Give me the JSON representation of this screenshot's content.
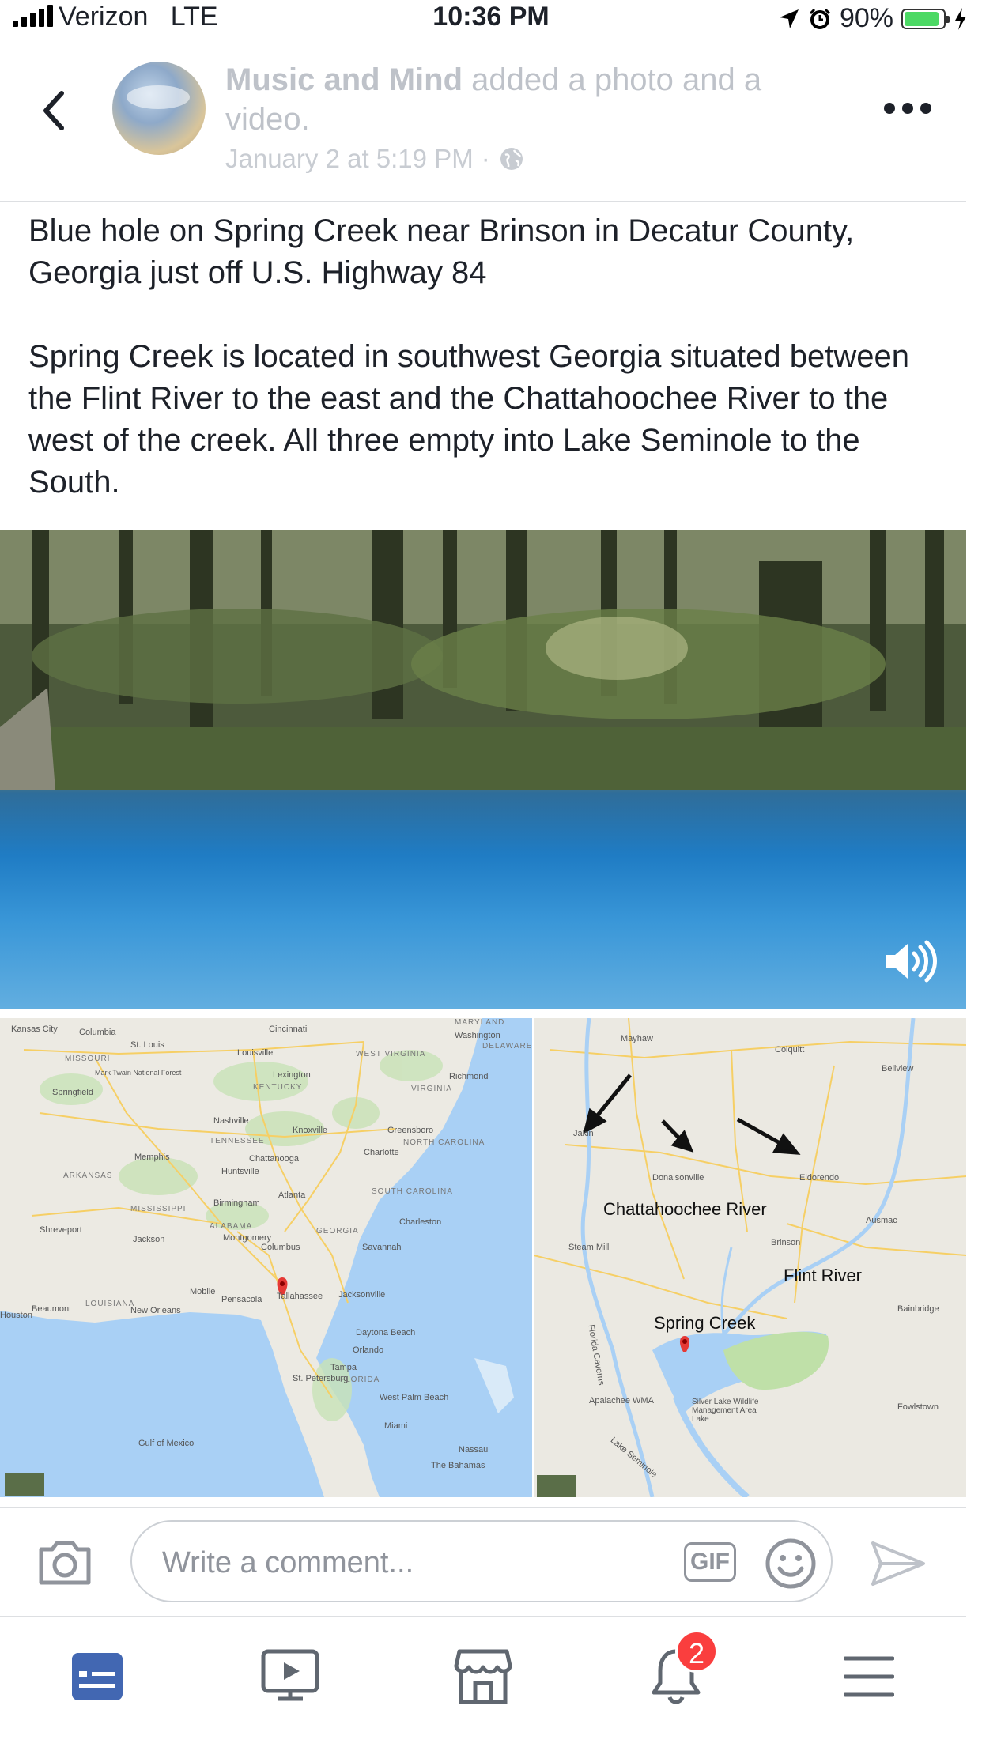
{
  "status_bar": {
    "carrier": "Verizon",
    "network": "LTE",
    "time": "10:36 PM",
    "battery_percent": "90%",
    "battery_level": 0.9
  },
  "post_header": {
    "author": "Music and Mind",
    "action": " added a photo and a video.",
    "date": "January 2 at 5:19 PM",
    "separator": "·",
    "privacy_icon": "globe-icon"
  },
  "post_body": {
    "paragraph_1": "Blue hole on Spring Creek near Brinson in Decatur County, Georgia just off U.S. Highway 84",
    "paragraph_2": "Spring Creek is located in southwest Georgia situated between the Flint River to the east and the Chattahoochee River to the west of the creek.  All three empty into Lake Seminole to the South."
  },
  "map": {
    "left_labels": {
      "kansas_city": "Kansas City",
      "columbia": "Columbia",
      "st_louis": "St. Louis",
      "missouri": "MISSOURI",
      "springfield": "Springfield",
      "louisville": "Louisville",
      "cincinnati": "Cincinnati",
      "west_virginia": "WEST VIRGINIA",
      "kentucky": "KENTUCKY",
      "lexington": "Lexington",
      "virginia": "VIRGINIA",
      "richmond": "Richmond",
      "washington": "Washington",
      "maryland": "MARYLAND",
      "delaware": "DELAWARE",
      "nashville": "Nashville",
      "knoxville": "Knoxville",
      "tennessee": "TENNESSEE",
      "greensboro": "Greensboro",
      "north_carolina": "NORTH CAROLINA",
      "charlotte": "Charlotte",
      "memphis": "Memphis",
      "chattanooga": "Chattanooga",
      "huntsville": "Huntsville",
      "arkansas": "ARKANSAS",
      "atlanta": "Atlanta",
      "south_carolina": "SOUTH CAROLINA",
      "mississippi": "MISSISSIPPI",
      "birmingham": "Birmingham",
      "alabama": "ALABAMA",
      "montgomery": "Montgomery",
      "georgia": "GEORGIA",
      "charleston": "Charleston",
      "shreveport": "Shreveport",
      "jackson": "Jackson",
      "columbus": "Columbus",
      "savannah": "Savannah",
      "louisiana": "LOUISIANA",
      "mobile": "Mobile",
      "pensacola": "Pensacola",
      "tallahassee": "Tallahassee",
      "jacksonville": "Jacksonville",
      "houston": "Houston",
      "new_orleans": "New Orleans",
      "orlando": "Orlando",
      "tampa": "Tampa",
      "st_petersburg": "St. Petersburg",
      "florida": "FLORIDA",
      "west_palm_beach": "West Palm Beach",
      "miami": "Miami",
      "gulf_of_mexico": "Gulf of Mexico",
      "the_bahamas": "The Bahamas",
      "nassau": "Nassau",
      "daytona": "Daytona Beach",
      "beaumont": "Beaumont",
      "mark_twain": "Mark Twain National Forest"
    },
    "right_labels": {
      "chattahoochee_river": "Chattahoochee River",
      "flint_river": "Flint River",
      "spring_creek": "Spring Creek",
      "mayhaw": "Mayhaw",
      "colquitt": "Colquitt",
      "bellview": "Bellview",
      "jakin": "Jakin",
      "donalsonville": "Donalsonville",
      "eldorendo": "Eldorendo",
      "steam_mill": "Steam Mill",
      "brinson": "Brinson",
      "ausmac": "Ausmac",
      "bainbridge": "Bainbridge",
      "apalachee_wma": "Apalachee WMA",
      "silver_lake": "Silver Lake Wildlife Management Area Lake",
      "lake_seminole": "Lake Seminole",
      "fowlstown": "Fowlstown",
      "florida_caverns": "Florida Caverns"
    }
  },
  "comment_bar": {
    "placeholder": "Write a comment...",
    "gif_label": "GIF"
  },
  "tab_bar": {
    "notifications_badge": "2"
  }
}
